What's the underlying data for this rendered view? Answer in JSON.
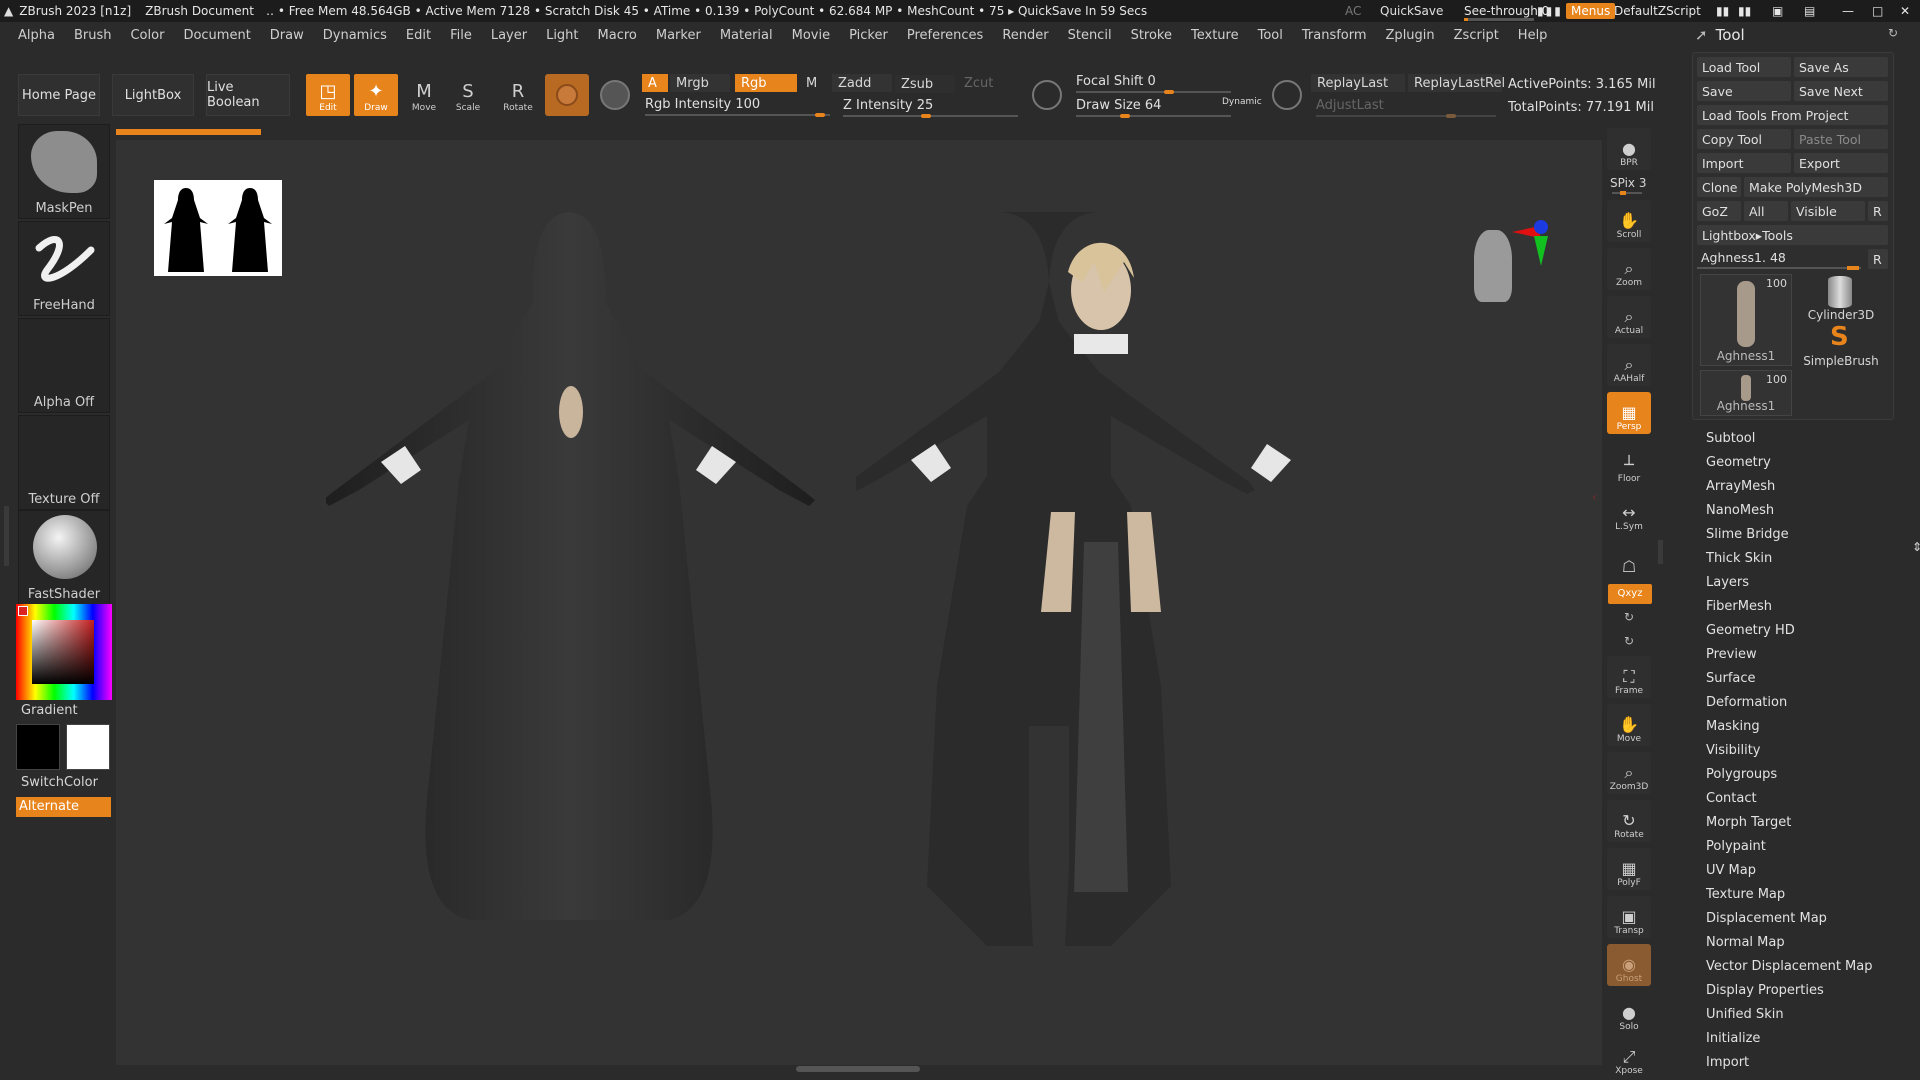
{
  "titlebar": {
    "app": "ZBrush 2023 [n1z]",
    "document": "ZBrush Document",
    "stats": "‥ • Free Mem 48.564GB • Active Mem 7128 • Scratch Disk 45 •  ATime • 0.139 • PolyCount • 62.684 MP  • MeshCount • 75   ▸ QuickSave In 59 Secs",
    "ac": "AC",
    "quicksave": "QuickSave",
    "see_through": "See-through  0",
    "see_through_value": 0.05,
    "menus": "Menus",
    "default_zscript": "DefaultZScript"
  },
  "menu": [
    "Alpha",
    "Brush",
    "Color",
    "Document",
    "Draw",
    "Dynamics",
    "Edit",
    "File",
    "Layer",
    "Light",
    "Macro",
    "Marker",
    "Material",
    "Movie",
    "Picker",
    "Preferences",
    "Render",
    "Stencil",
    "Stroke",
    "Texture",
    "Tool",
    "Transform",
    "Zplugin",
    "Zscript",
    "Help"
  ],
  "shelf": {
    "home_page": "Home Page",
    "lightbox": "LightBox",
    "live_boolean": "Live Boolean",
    "tools": [
      {
        "label": "Edit",
        "active": true,
        "icon": "◳"
      },
      {
        "label": "Draw",
        "active": true,
        "icon": "✦"
      },
      {
        "label": "Move",
        "active": false,
        "icon": "M"
      },
      {
        "label": "Scale",
        "active": false,
        "icon": "S"
      },
      {
        "label": "Rotate",
        "active": false,
        "icon": "R"
      }
    ],
    "a": "A",
    "mrgb": "Mrgb",
    "rgb": "Rgb",
    "m": "M",
    "zadd": "Zadd",
    "zsub": "Zsub",
    "zcut": "Zcut",
    "rgb_intensity": "Rgb Intensity 100",
    "z_intensity": "Z Intensity 25",
    "focal_shift": "Focal Shift 0",
    "draw_size": "Draw Size 64",
    "dynamic": "Dynamic",
    "replay_last": "ReplayLast",
    "replay_last_rel": "ReplayLastRel",
    "adjust_last": "AdjustLast",
    "active_points": "ActivePoints: 3.165 Mil",
    "total_points": "TotalPoints: 77.191 Mil"
  },
  "left": {
    "maskpen": "MaskPen",
    "freehand": "FreeHand",
    "alpha_off": "Alpha Off",
    "texture_off": "Texture Off",
    "fastshader": "FastShader",
    "gradient": "Gradient",
    "switchcolor": "SwitchColor",
    "alternate": "Alternate"
  },
  "right_tools": [
    {
      "label": "BPR",
      "icon": "●"
    },
    {
      "label": "SPix 3",
      "icon": ""
    },
    {
      "label": "Scroll",
      "icon": "✋"
    },
    {
      "label": "Zoom",
      "icon": "⌕"
    },
    {
      "label": "Actual",
      "icon": "⌕"
    },
    {
      "label": "AAHalf",
      "icon": "⌕"
    },
    {
      "label": "Persp",
      "icon": "▦"
    },
    {
      "label": "Floor",
      "icon": "┴"
    },
    {
      "label": "L.Sym",
      "icon": "↔"
    },
    {
      "label": "",
      "icon": "☖"
    },
    {
      "label": "Qxyz",
      "icon": ""
    },
    {
      "label": "Frame",
      "icon": "⛶"
    },
    {
      "label": "Move",
      "icon": "✋"
    },
    {
      "label": "Zoom3D",
      "icon": "⌕"
    },
    {
      "label": "Rotate",
      "icon": "↻"
    },
    {
      "label": "PolyF",
      "icon": "▦"
    },
    {
      "label": "Transp",
      "icon": "▣"
    },
    {
      "label": "Ghost",
      "icon": "◉"
    },
    {
      "label": "Solo",
      "icon": "●"
    },
    {
      "label": "Xpose",
      "icon": "⤢"
    }
  ],
  "tool_panel": {
    "title": "Tool",
    "load_tool": "Load Tool",
    "save_as": "Save As",
    "save": "Save",
    "save_next": "Save Next",
    "load_from_project": "Load Tools From Project",
    "copy_tool": "Copy Tool",
    "paste_tool": "Paste Tool",
    "import": "Import",
    "export": "Export",
    "clone": "Clone",
    "make_polymesh": "Make PolyMesh3D",
    "goz": "GoZ",
    "all": "All",
    "visible": "Visible",
    "r": "R",
    "lightbox_tools": "Lightbox▸Tools",
    "current_tool": "Aghness1. 48",
    "thumbs": [
      {
        "name": "Aghness1",
        "count": "100"
      },
      {
        "name": "Cylinder3D",
        "count": ""
      },
      {
        "name": "SimpleBrush",
        "count": ""
      },
      {
        "name": "Aghness1",
        "count": "100"
      }
    ],
    "sections": [
      "Subtool",
      "Geometry",
      "ArrayMesh",
      "NanoMesh",
      "Slime Bridge",
      "Thick Skin",
      "Layers",
      "FiberMesh",
      "Geometry HD",
      "Preview",
      "Surface",
      "Deformation",
      "Masking",
      "Visibility",
      "Polygroups",
      "Contact",
      "Morph Target",
      "Polypaint",
      "UV Map",
      "Texture Map",
      "Displacement Map",
      "Normal Map",
      "Vector Displacement Map",
      "Display Properties",
      "Unified Skin",
      "Initialize",
      "Import"
    ]
  }
}
